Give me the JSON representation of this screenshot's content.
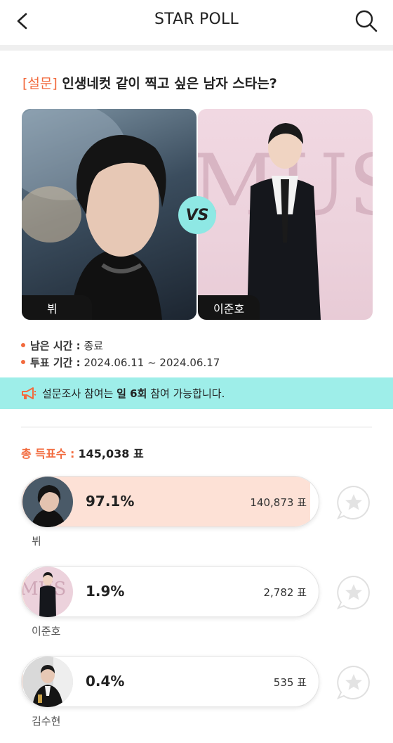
{
  "header": {
    "title": "STAR POLL"
  },
  "poll": {
    "tag": "[설문]",
    "question": "인생네컷 같이 찍고 싶은 남자 스타는?",
    "vs": "VS",
    "left": {
      "name": "뷔"
    },
    "right": {
      "name": "이준호"
    },
    "remaining_label": "남은 시간 :",
    "remaining_value": "종료",
    "period_label": "투표 기간 :",
    "period_value": "2024.06.11 ~ 2024.06.17",
    "notice_pre": "설문조사 참여는",
    "notice_bold": "일 6회",
    "notice_post": "참여 가능합니다.",
    "total_label": "총 득표수 :",
    "total_value": "145,038 표"
  },
  "results": [
    {
      "name": "뷔",
      "percent": "97.1%",
      "votes": "140,873 표",
      "share": 0.971
    },
    {
      "name": "이준호",
      "percent": "1.9%",
      "votes": "2,782 표",
      "share": 0.019
    },
    {
      "name": "김수현",
      "percent": "0.4%",
      "votes": "535 표",
      "share": 0.004
    }
  ],
  "colors": {
    "accent": "#f26a3d",
    "mint": "#9eeee9",
    "bar_fill": "#fde1d6"
  }
}
